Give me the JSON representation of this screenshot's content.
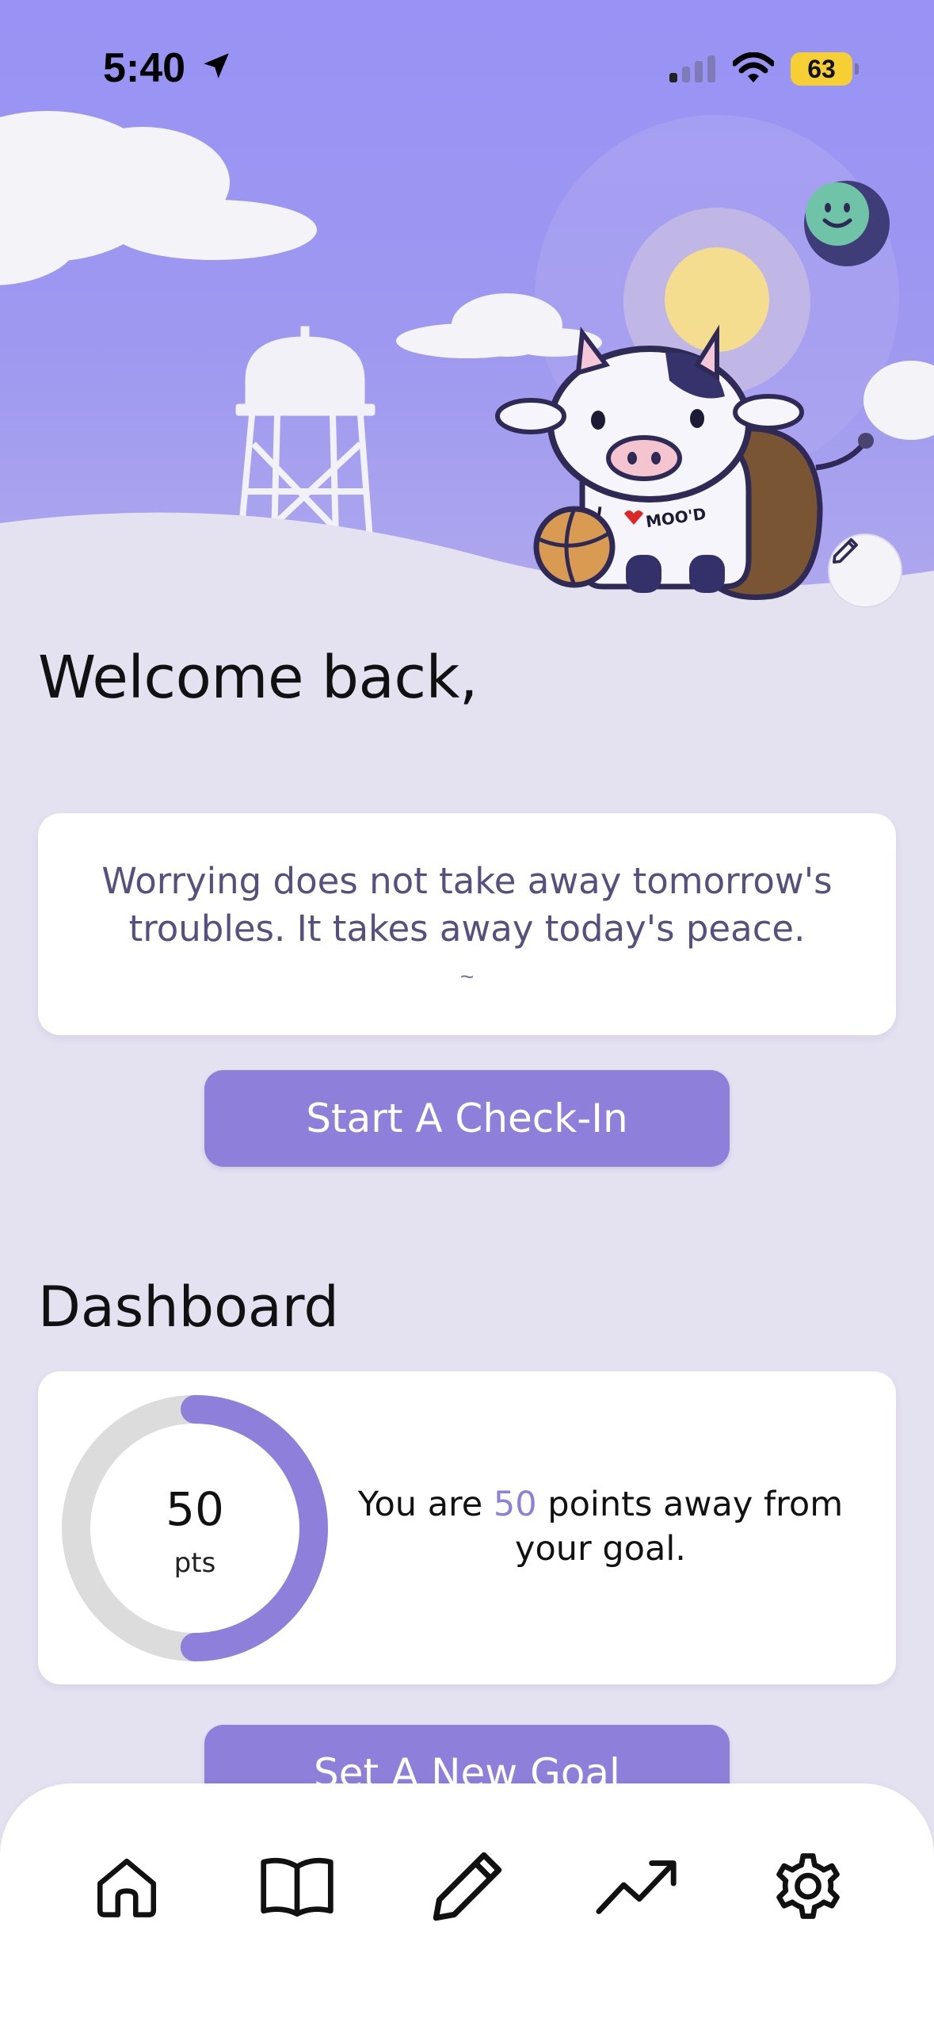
{
  "status_bar": {
    "time": "5:40",
    "battery": "63",
    "icons": [
      "location-arrow-icon",
      "signal-icon",
      "wifi-icon",
      "battery-icon"
    ]
  },
  "header": {
    "illustration_text": "I ♥ MOO'D",
    "mood_icon": "smiley-face-icon",
    "edit_icon": "pencil-icon"
  },
  "greeting": {
    "title": "Welcome back,"
  },
  "quote": {
    "text": "Worrying does not take away tomorrow's troubles. It takes away today's peace.",
    "author": "~"
  },
  "checkin_button": {
    "label": "Start  A Check-In"
  },
  "dashboard": {
    "title": "Dashboard",
    "points": "50",
    "points_unit": "pts",
    "progress_fraction": 0.5,
    "message_prefix": "You are ",
    "message_value": "50",
    "message_suffix": " points away from your goal."
  },
  "goal_button": {
    "label": "Set A New Goal"
  },
  "tab_bar": {
    "tabs": [
      "home-icon",
      "book-icon",
      "pencil-icon",
      "trending-up-icon",
      "gear-icon"
    ]
  },
  "colors": {
    "accent": "#8e7fda",
    "sky": "#9893f5",
    "background": "#e4e1f1",
    "quote_text": "#56507e"
  }
}
